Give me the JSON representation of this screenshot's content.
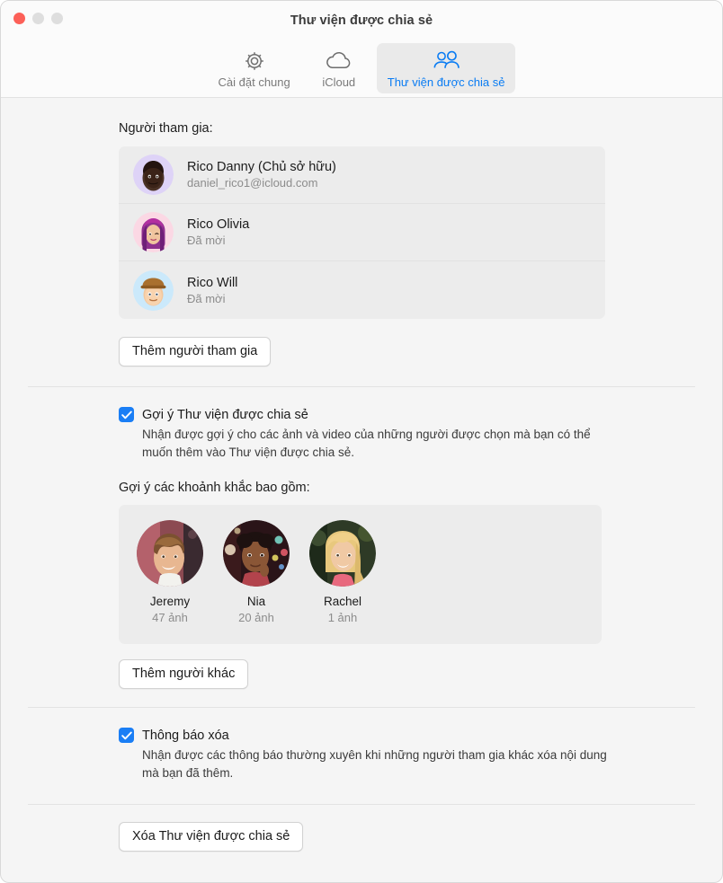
{
  "window": {
    "title": "Thư viện được chia sẻ",
    "traffic_lights": [
      "close",
      "minimize",
      "zoom"
    ]
  },
  "toolbar": {
    "tabs": [
      {
        "label": "Cài đặt chung",
        "icon": "gear-icon",
        "selected": false
      },
      {
        "label": "iCloud",
        "icon": "cloud-icon",
        "selected": false
      },
      {
        "label": "Thư viện được chia sẻ",
        "icon": "two-people-icon",
        "selected": true
      }
    ],
    "accent_color": "#0a7cf3"
  },
  "participants": {
    "label": "Người tham gia:",
    "rows": [
      {
        "name": "Rico Danny (Chủ sở hữu)",
        "detail": "daniel_rico1@icloud.com",
        "avatar": "memoji-danny"
      },
      {
        "name": "Rico Olivia",
        "detail": "Đã mời",
        "avatar": "memoji-olivia"
      },
      {
        "name": "Rico Will",
        "detail": "Đã mời",
        "avatar": "memoji-will"
      }
    ],
    "add_button": "Thêm người tham gia"
  },
  "suggestions": {
    "checkbox_label": "Gợi ý Thư viện được chia sẻ",
    "checkbox_checked": true,
    "description": "Nhận được gợi ý cho các ảnh và video của những người được chọn mà bạn có thể muốn thêm vào Thư viện được chia sẻ.",
    "people_label": "Gợi ý các khoảnh khắc bao gồm:",
    "people": [
      {
        "name": "Jeremy",
        "count": "47 ảnh",
        "photo": "photo-jeremy"
      },
      {
        "name": "Nia",
        "count": "20 ảnh",
        "photo": "photo-nia"
      },
      {
        "name": "Rachel",
        "count": "1 ảnh",
        "photo": "photo-rachel"
      }
    ],
    "add_other_button": "Thêm người khác"
  },
  "notifications": {
    "checkbox_label": "Thông báo xóa",
    "checkbox_checked": true,
    "description": "Nhận được các thông báo thường xuyên khi những người tham gia khác xóa nội dung mà bạn đã thêm."
  },
  "footer": {
    "delete_button": "Xóa Thư viện được chia sẻ"
  },
  "colors": {
    "accent": "#0a7cf3",
    "checkbox": "#1a7ef5",
    "window_bg": "#f5f5f5",
    "box_bg": "#ececec",
    "close_light": "#fc6058"
  }
}
